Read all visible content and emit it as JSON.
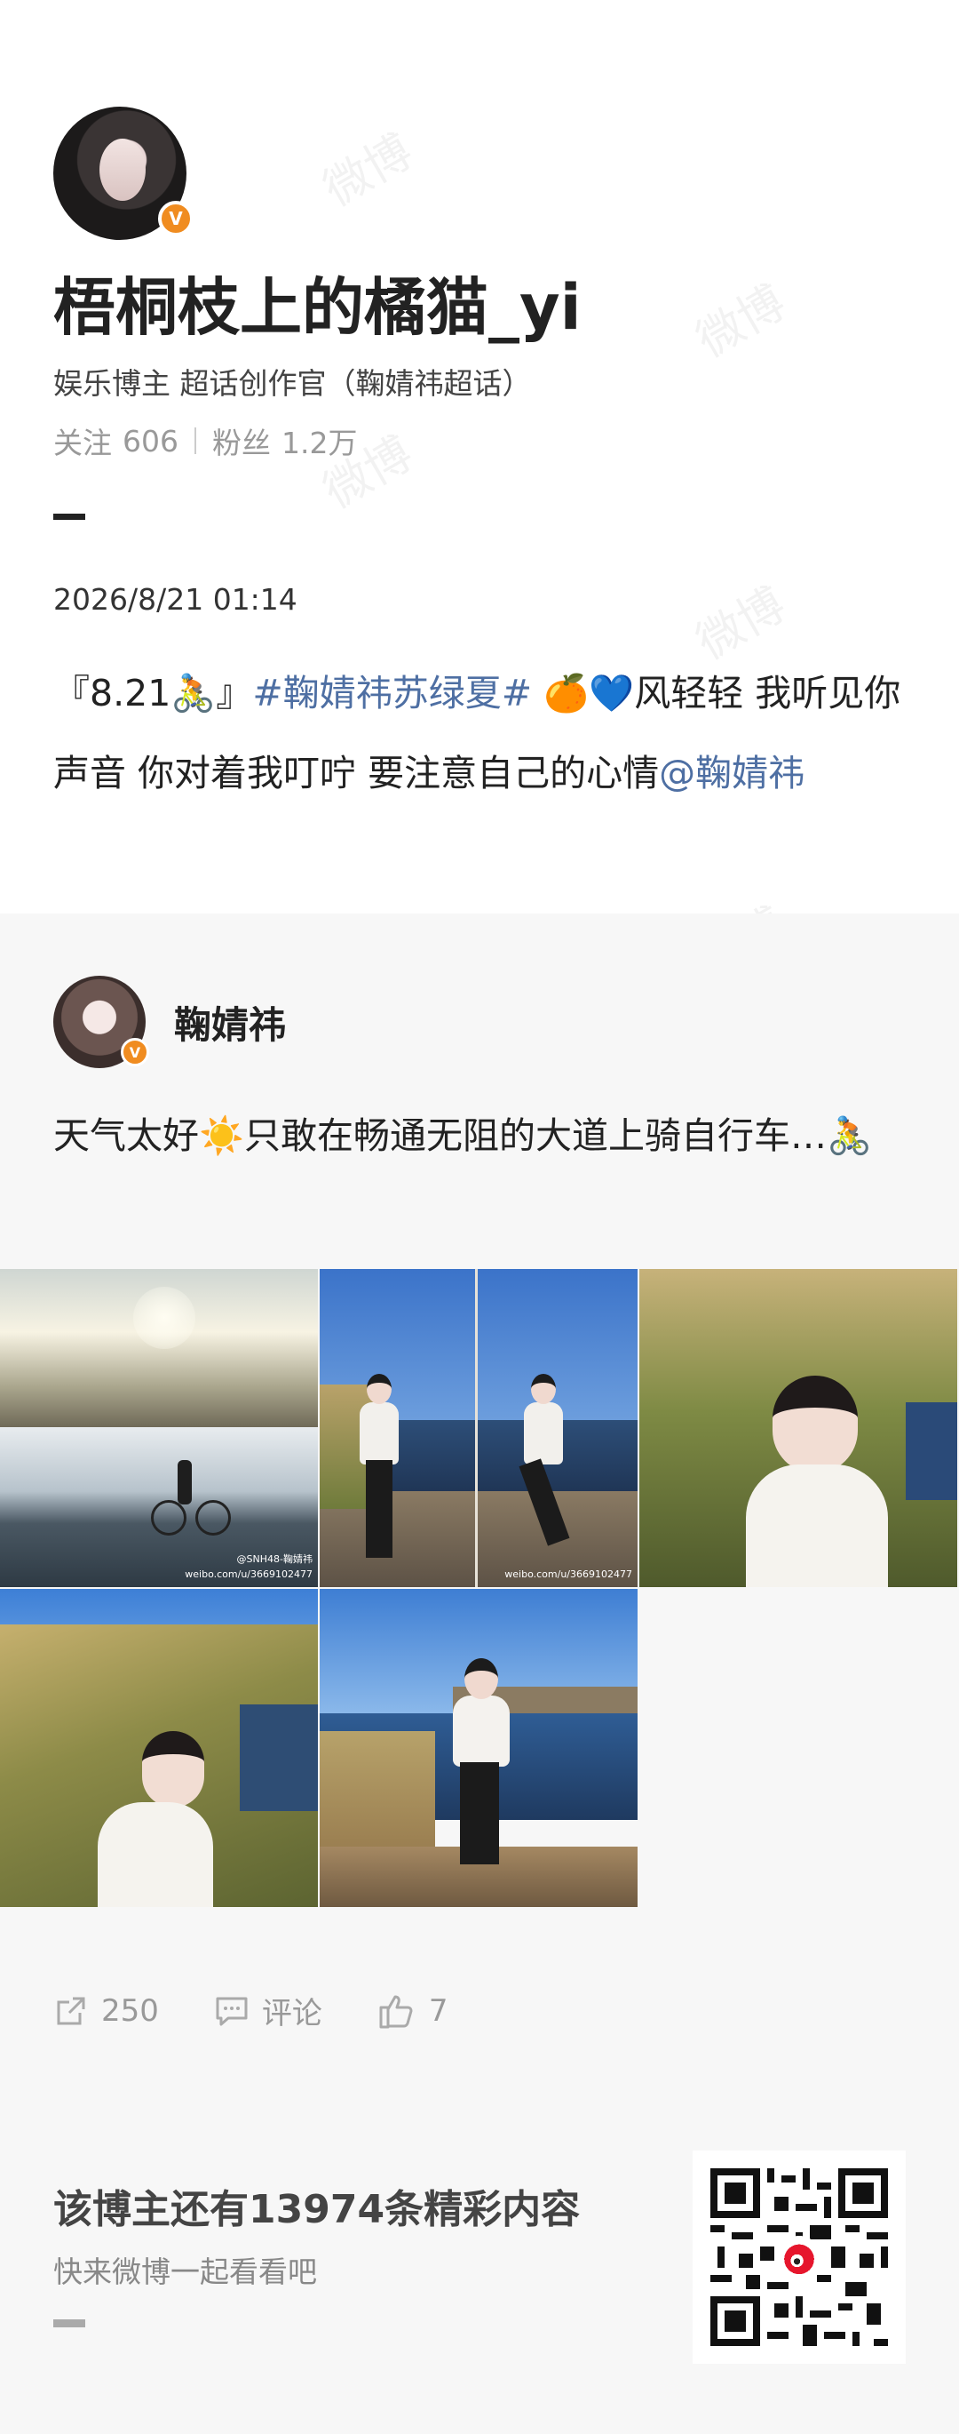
{
  "profile": {
    "name": "梧桐枝上的橘猫_yi",
    "subtitle": "娱乐博主 超话创作官（鞠婧祎超话）",
    "following_label": "关注",
    "following_count": "606",
    "followers_label": "粉丝",
    "followers_count": "1.2万",
    "verified_badge": "V"
  },
  "post": {
    "date": "2026/8/21 01:14",
    "text_prefix": "『8.21🚴』",
    "topic": "#鞠婧祎苏绿夏#",
    "text_middle": " 🍊💙风轻轻 我听见你声音 你对着我叮咛 要注意自己的心情",
    "mention": "@鞠婧祎"
  },
  "retweet": {
    "author": "鞠婧祎",
    "text": "天气太好☀️只敢在畅通无阻的大道上骑自行车…🚴",
    "image_watermarks": [
      "@SNH48-鞠婧祎",
      "weibo.com/u/3669102477"
    ]
  },
  "actions": {
    "repost_count": "250",
    "comment_label": "评论",
    "like_count": "7"
  },
  "footer": {
    "promo_title": "该博主还有13974条精彩内容",
    "promo_sub": "快来微博一起看看吧"
  },
  "watermark_text": "微博",
  "colors": {
    "link_blue": "#4e6fa3",
    "badge_orange": "#f08c20",
    "retweet_bg": "#f7f7f7"
  }
}
